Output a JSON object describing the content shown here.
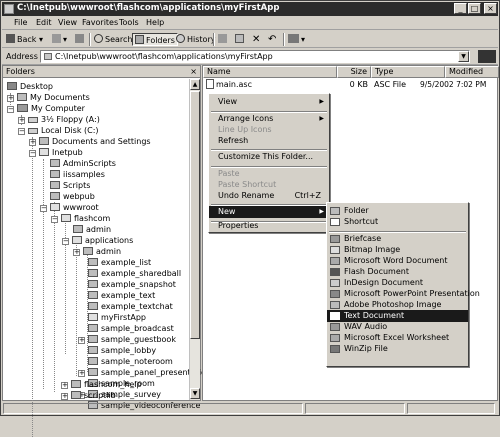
{
  "window": {
    "title": "C:\\Inetpub\\wwwroot\\flashcom\\applications\\myFirstApp"
  },
  "menubar": [
    "File",
    "Edit",
    "View",
    "Favorites",
    "Tools",
    "Help"
  ],
  "toolbar": {
    "back": "Back",
    "search": "Search",
    "folders": "Folders",
    "history": "History"
  },
  "address": {
    "label": "Address",
    "value": "C:\\Inetpub\\wwwroot\\flashcom\\applications\\myFirstApp"
  },
  "folders_pane": {
    "title": "Folders",
    "close": "×",
    "items": [
      "Desktop",
      "My Documents",
      "My Computer",
      "3½ Floppy (A:)",
      "Local Disk (C:)",
      "Documents and Settings",
      "Inetpub",
      "AdminScripts",
      "iissamples",
      "Scripts",
      "webpub",
      "wwwroot",
      "flashcom",
      "admin",
      "applications",
      "admin",
      "example_list",
      "example_sharedball",
      "example_snapshot",
      "example_text",
      "example_textchat",
      "myFirstApp",
      "sample_broadcast",
      "sample_guestbook",
      "sample_lobby",
      "sample_noteroom",
      "sample_panel_presentation",
      "sample_room",
      "sample_survey",
      "sample_videoconference",
      "flashcom_help",
      "scriptlib"
    ]
  },
  "file_list": {
    "columns": [
      "Name",
      "Size",
      "Type",
      "Modified"
    ],
    "rows": [
      {
        "name": "main.asc",
        "size": "0 KB",
        "type": "ASC File",
        "modified": "9/5/2002 7:02 PM"
      }
    ]
  },
  "context_menu": {
    "items": [
      "View",
      "Arrange Icons",
      "Line Up Icons",
      "Refresh",
      "Customize This Folder...",
      "Paste",
      "Paste Shortcut",
      "Undo Rename",
      "New",
      "Properties"
    ],
    "undo_accel": "Ctrl+Z"
  },
  "new_submenu": {
    "items": [
      "Folder",
      "Shortcut",
      "Briefcase",
      "Bitmap Image",
      "Microsoft Word Document",
      "Flash Document",
      "InDesign Document",
      "Microsoft PowerPoint Presentation",
      "Adobe Photoshop Image",
      "Text Document",
      "WAV Audio",
      "Microsoft Excel Worksheet",
      "WinZip File"
    ]
  },
  "icons": [
    "back-arrow-icon",
    "forward-arrow-icon",
    "up-folder-icon",
    "search-icon",
    "folders-icon",
    "history-icon",
    "move-to-icon",
    "copy-to-icon",
    "delete-icon",
    "undo-icon",
    "views-icon",
    "folder-icon",
    "drive-icon",
    "computer-icon"
  ],
  "colors": {
    "titlebar": "#2b2b2b",
    "selection": "#1a1a1a",
    "face": "#d4d0c8"
  }
}
